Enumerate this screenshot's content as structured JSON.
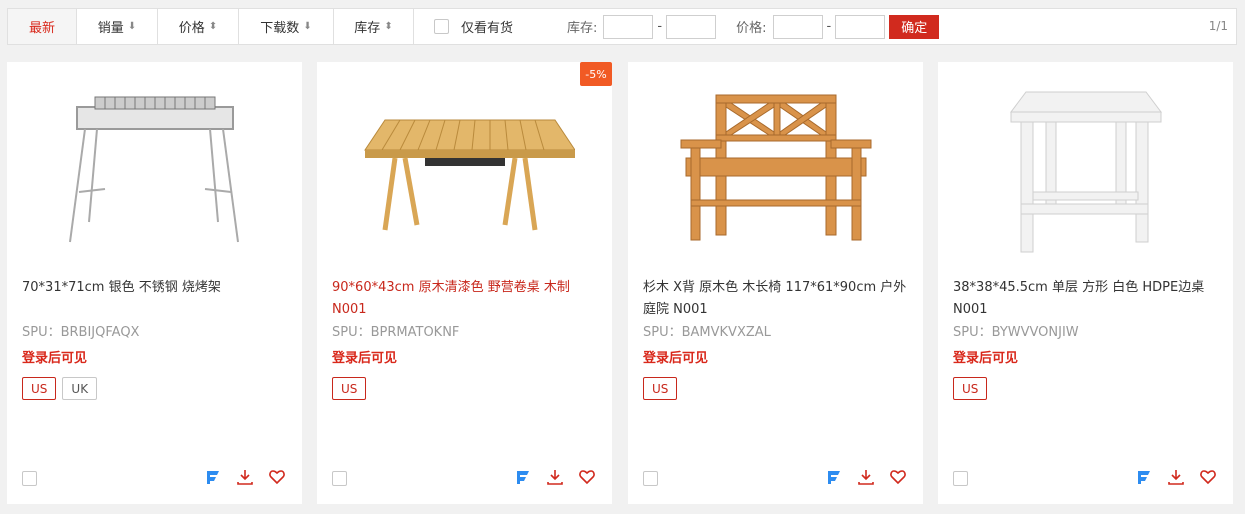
{
  "sort_bar": {
    "items": [
      {
        "label": "最新",
        "arrow": ""
      },
      {
        "label": "销量",
        "arrow": "⬇"
      },
      {
        "label": "价格",
        "arrow": "⬍"
      },
      {
        "label": "下载数",
        "arrow": "⬇"
      },
      {
        "label": "库存",
        "arrow": "⬍"
      }
    ],
    "in_stock_label": "仅看有货",
    "stock_range_label": "库存:",
    "price_range_label": "价格:",
    "dash": "-",
    "confirm_label": "确定",
    "pager": "1/1"
  },
  "colors": {
    "accent": "#d12a1e",
    "discount": "#f15a24"
  },
  "products": [
    {
      "title": "70*31*71cm 银色 不锈钢 烧烤架",
      "title_highlight": false,
      "spu": "SPU：BRBIJQFAQX",
      "login_text": "登录后可见",
      "tags": [
        "US",
        "UK"
      ],
      "discount": "",
      "image": "bbq-grill-image"
    },
    {
      "title": "90*60*43cm 原木清漆色 野营卷桌 木制 N001",
      "title_highlight": true,
      "spu": "SPU：BPRMATOKNF",
      "login_text": "登录后可见",
      "tags": [
        "US"
      ],
      "discount": "-5%",
      "image": "camping-table-image"
    },
    {
      "title": "杉木 X背 原木色 木长椅 117*61*90cm 户外庭院 N001",
      "title_highlight": false,
      "spu": "SPU：BAMVKVXZAL",
      "login_text": "登录后可见",
      "tags": [
        "US"
      ],
      "discount": "",
      "image": "wooden-bench-image"
    },
    {
      "title": "38*38*45.5cm 单层 方形 白色 HDPE边桌 N001",
      "title_highlight": false,
      "spu": "SPU：BYWVVONJIW",
      "login_text": "登录后可见",
      "tags": [
        "US"
      ],
      "discount": "",
      "image": "side-table-image"
    }
  ],
  "action_icons": [
    "brand-f-icon",
    "download-icon",
    "heart-icon"
  ]
}
